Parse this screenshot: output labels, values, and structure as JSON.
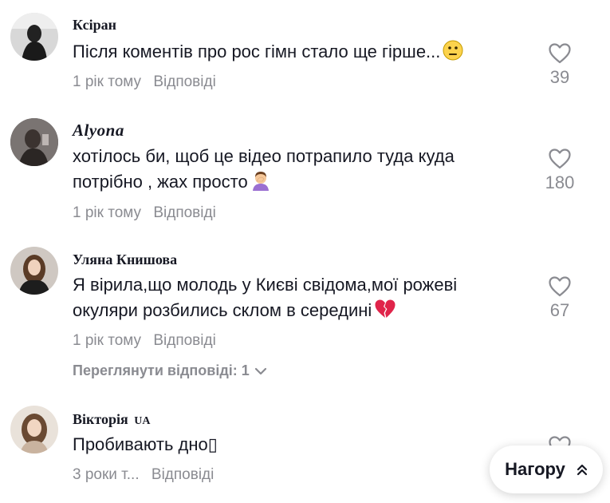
{
  "comments": [
    {
      "username": "Ксіран",
      "text_lines": [
        "Після коментів про рос гімн стало ще гірше..."
      ],
      "time": "1 рік тому",
      "reply_label": "Відповіді",
      "likes": "39",
      "emoji": "neutral-face"
    },
    {
      "username": "Alyona",
      "text_lines": [
        "хотілось би, щоб це відео потрапило туда куда",
        "потрібно , жах просто"
      ],
      "time": "1 рік тому",
      "reply_label": "Відповіді",
      "likes": "180",
      "emoji": "facepalm"
    },
    {
      "username": "Уляна Книшова",
      "text_lines": [
        "Я вірила,що молодь у Києві свідома,мої рожеві",
        "окуляри розбились склом в середині"
      ],
      "time": "1 рік тому",
      "reply_label": "Відповіді",
      "likes": "67",
      "emoji": "broken-heart",
      "view_replies": "Переглянути відповіді: 1"
    },
    {
      "username": "Вікторія",
      "username_badge": "UA",
      "text_lines": [
        "Пробивають дно▯"
      ],
      "time": "3 роки т...",
      "reply_label": "Відповіді",
      "likes": ""
    }
  ],
  "top_button": {
    "label": "Нагору"
  },
  "colors": {
    "text": "#161823",
    "muted": "#8a8b91",
    "accent_heart": "#e0244a"
  }
}
